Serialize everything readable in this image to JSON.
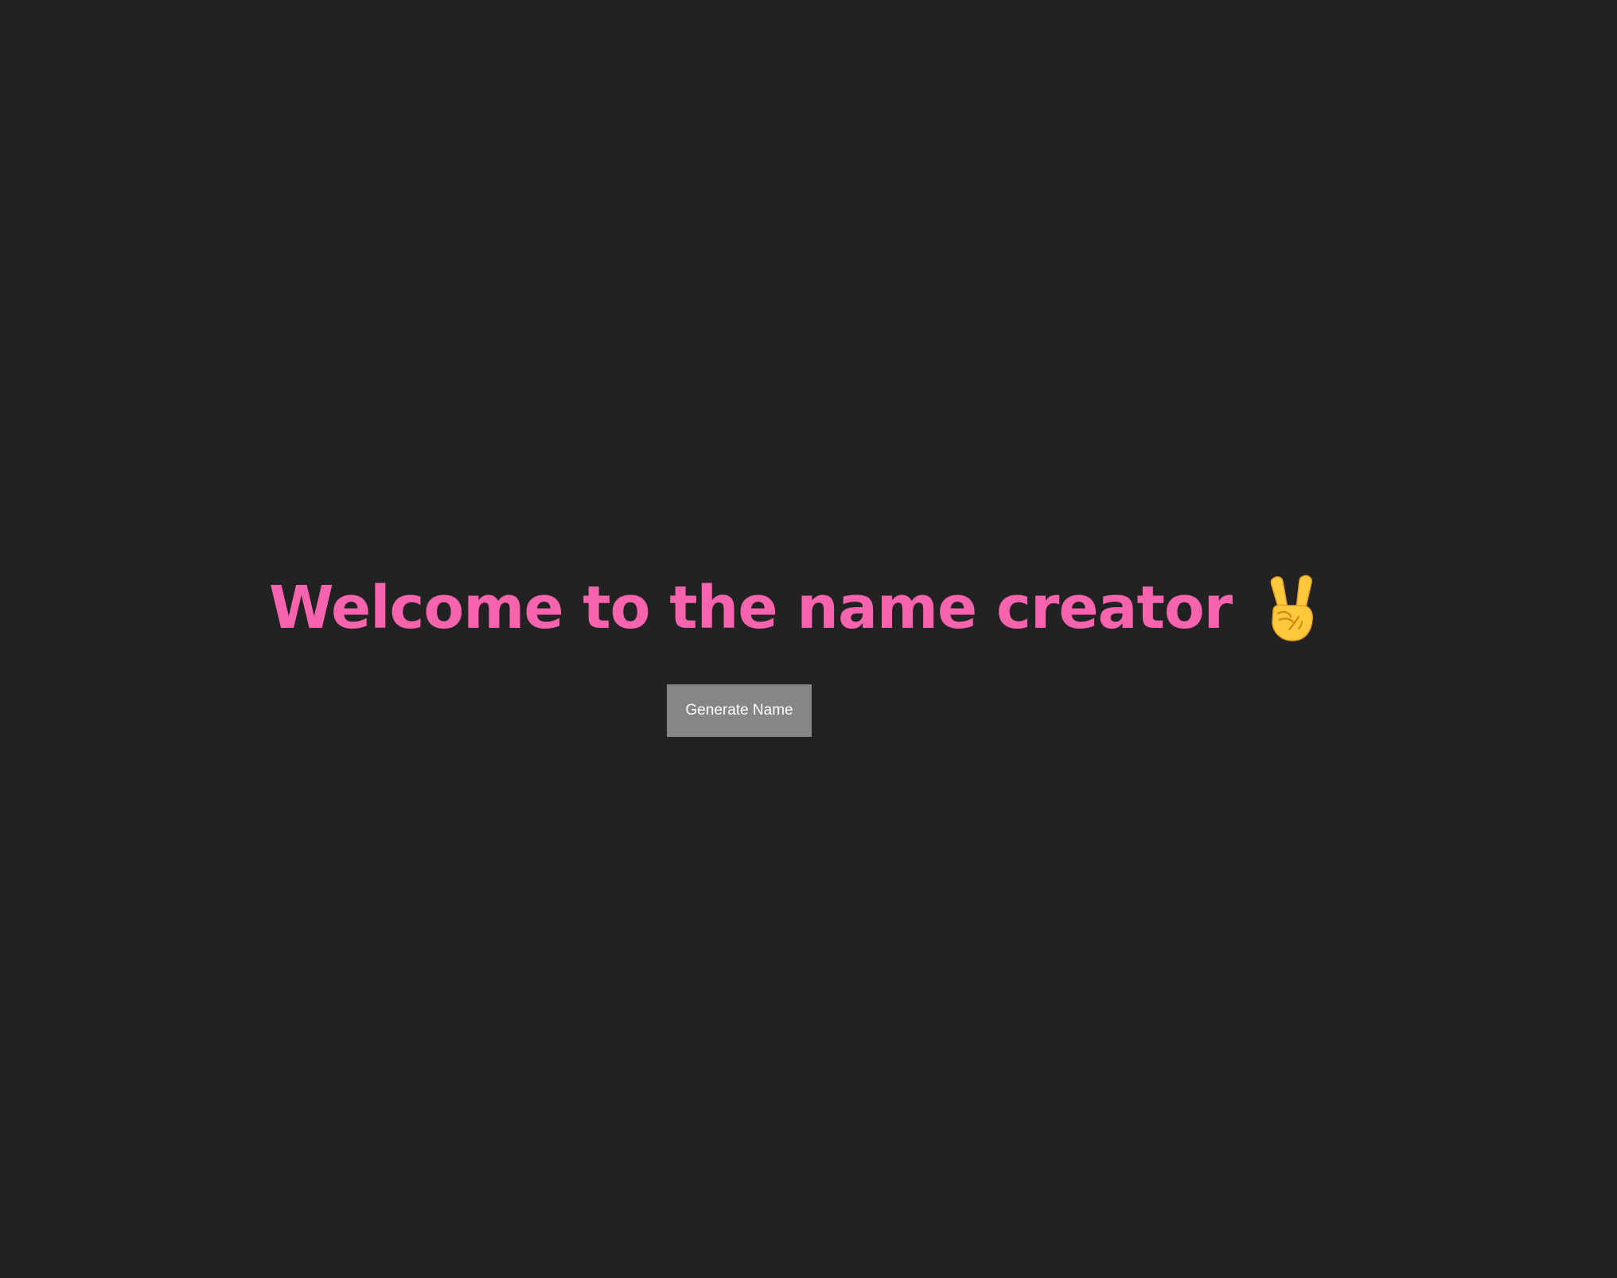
{
  "heading": {
    "title": "Welcome to the name creator",
    "icon": "victory-hand-icon",
    "color": "#f763ad"
  },
  "actions": {
    "generate_label": "Generate Name",
    "button_bg": "#868686",
    "button_text_color": "#ffffff"
  },
  "theme": {
    "background": "#222222"
  }
}
